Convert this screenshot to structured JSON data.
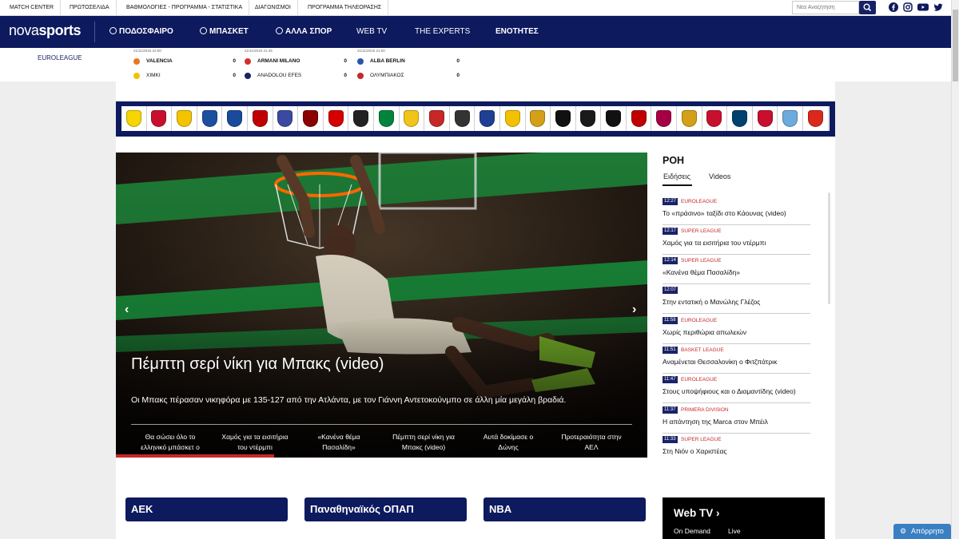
{
  "topbar": {
    "links": [
      "MATCH CENTER",
      "ΠΡΩΤΟΣΕΛΙΔΑ",
      "ΒΑΘΜΟΛΟΓΙΕΣ - ΠΡΟΓΡΑΜΜΑ - ΣΤΑΤΙΣΤΙΚΑ",
      "ΔΙΑΓΩΝΙΣΜΟΙ",
      "ΠΡΟΓΡΑΜΜΑ ΤΗΛΕΟΡΑΣΗΣ"
    ],
    "search_placeholder": "Νέα Αναζήτηση"
  },
  "nav": {
    "logo_prefix": "nova",
    "logo_suffix": "sports",
    "items": [
      "ΠΟΔΟΣΦΑΙΡΟ",
      "ΜΠΑΣΚΕΤ",
      "ΑΛΛΑ ΣΠΟΡ",
      "WEB TV",
      "THE EXPERTS",
      "ΕΝΟΤΗΤΕΣ"
    ]
  },
  "scores": {
    "league": "EUROLEAGUE",
    "matches": [
      {
        "time": "21/11/2019 22:00",
        "home": "VALENCIA",
        "home_score": "0",
        "away": "ΧΙΜΚΙ",
        "away_score": "0"
      },
      {
        "time": "21/11/2019 21:45",
        "home": "ARMANI MILANO",
        "home_score": "0",
        "away": "ANADOLOU EFES",
        "away_score": "0"
      },
      {
        "time": "21/11/2019 21:00",
        "home": "ALBA BERLIN",
        "home_score": "0",
        "away": "ΟΛΥΜΠΙΑΚΟΣ",
        "away_score": "0"
      }
    ],
    "match_center_label": "MATCH CENTER"
  },
  "club_colors": [
    "#f6d500",
    "#c8102e",
    "#f3c300",
    "#1d4fa0",
    "#1a4a9c",
    "#c00000",
    "#3b4aa0",
    "#8b0000",
    "#d50000",
    "#222222",
    "#00843d",
    "#f0c419",
    "#c62828",
    "#333333",
    "#1e3f94",
    "#f2c200",
    "#d4a017",
    "#111111",
    "#1a1a1a",
    "#111111",
    "#c00000",
    "#a50044",
    "#d4a017",
    "#c8102e",
    "#004170",
    "#c8102e",
    "#6cabdd",
    "#da291c",
    "#cc0033"
  ],
  "hero": {
    "title": "Πέμπτη σερί νίκη για Μπακς (video)",
    "subtitle": "Οι Μπακς πέρασαν νικηφόρα με 135-127 από την Ατλάντα, με τον Γιάννη Αντετοκούνμπο σε άλλη μία μεγάλη βραδιά.",
    "prev": "‹",
    "next": "›",
    "tabs": [
      [
        "Θα σώσει όλο το",
        "ελληνικό μπάσκετ ο"
      ],
      [
        "Χαμός για τα εισιτήρια",
        "του ντέρμπι"
      ],
      [
        "«Κανένα θέμα",
        "Πασαλίδη»"
      ],
      [
        "Πέμπτη σερί νίκη για",
        "Μπακς (video)"
      ],
      [
        "Αυτά δοκίμασε ο",
        "Δώνης"
      ],
      [
        "Προτεραιότητα στην",
        "ΑΕΛ"
      ]
    ],
    "active_tab_progress": 0.3
  },
  "sidebar": {
    "title": "ΡΟΗ",
    "tabs": [
      "Ειδήσεις",
      "Videos"
    ],
    "news": [
      {
        "time": "12:27",
        "category": "EUROLEAGUE",
        "title": "Το «πράσινο» ταξίδι στο Κάουνας (video)"
      },
      {
        "time": "12:17",
        "category": "SUPER LEAGUE",
        "title": "Χαμός για τα εισιτήρια του ντέρμπι"
      },
      {
        "time": "12:14",
        "category": "SUPER LEAGUE",
        "title": "«Κανένα θέμα Πασαλίδη»"
      },
      {
        "time": "12:07",
        "category": "",
        "title": "Στην εντατική ο Μανώλης Γλέζος"
      },
      {
        "time": "11:58",
        "category": "EUROLEAGUE",
        "title": "Χωρίς περιθώρια απωλειών"
      },
      {
        "time": "11:51",
        "category": "BASKET LEAGUE",
        "title": "Αναμένεται Θεσσαλονίκη ο Φιτζπάτρικ"
      },
      {
        "time": "11:47",
        "category": "EUROLEAGUE",
        "title": "Στους υποψήφιους και ο Διαμαντίδης (video)"
      },
      {
        "time": "11:37",
        "category": "PRIMERA DIVISION",
        "title": "Η απάντηση της Marca στον Μπέιλ"
      },
      {
        "time": "11:33",
        "category": "SUPER LEAGUE",
        "title": "Στη Νιόν ο Χαριστέας"
      }
    ]
  },
  "sections": [
    "ΑΕΚ",
    "Παναθηναϊκός ΟΠΑΠ",
    "NBA"
  ],
  "webtv": {
    "title": "Web TV ›",
    "tabs": [
      "On Demand",
      "Live"
    ]
  },
  "help_button": "Απόρρητο"
}
